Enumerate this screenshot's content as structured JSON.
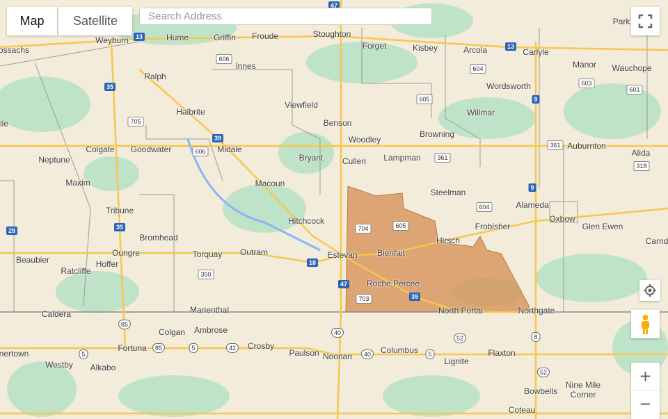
{
  "controls": {
    "map_tab": "Map",
    "satellite_tab": "Satellite",
    "active_tab": "Map",
    "search_placeholder": "Search Address",
    "zoom_in": "+",
    "zoom_out": "−",
    "fullscreen_icon": "fullscreen-icon",
    "locate_icon": "my-location-icon",
    "pegman_icon": "street-view-pegman-icon"
  },
  "colors": {
    "land": "#f4ecda",
    "park": "#bfe3c8",
    "road": "#f7c64a",
    "highlight_region": "#d7925a",
    "border": "#8a8a8a",
    "water": "#8ab4f8"
  },
  "towns": [
    "Hume",
    "Griffin",
    "Froude",
    "Stoughton",
    "Weyburn",
    "Forget",
    "Kisbey",
    "Arcola",
    "Carlyle",
    "Park",
    "ossachs",
    "Innes",
    "Manor",
    "Wauchope",
    "Ralph",
    "Wordsworth",
    "Viewfield",
    "Willmar",
    "Halbrite",
    "Benson",
    "lle",
    "Browning",
    "Woodley",
    "Auburnton",
    "Colgate",
    "Goodwater",
    "Midale",
    "Alida",
    "Neptune",
    "Bryant",
    "Cullen",
    "Lampman",
    "Maxim",
    "Macoun",
    "Steelman",
    "Alameda",
    "Tribune",
    "Oxbow",
    "Hitchcock",
    "Frobisher",
    "Glen Ewen",
    "Bromhead",
    "Hirsch",
    "Carnd",
    "Oungre",
    "Torquay",
    "Outram",
    "Estevan",
    "Bienfait",
    "Beaubier",
    "Hoffer",
    "Ratcliffe",
    "Roche Percee",
    "Marienthal",
    "North Portal",
    "Northgate",
    "Caldera",
    "Colgan",
    "Ambrose",
    "Fortuna",
    "Crosby",
    "Paulson",
    "Noonan",
    "Columbus",
    "Flaxton",
    "Lignite",
    "nertown",
    "Westby",
    "Alkabo",
    "Nine Mile",
    "Corner",
    "Bowbells",
    "Coteau"
  ],
  "routes": [
    "13",
    "13",
    "47",
    "47",
    "606",
    "606",
    "35",
    "35",
    "705",
    "39",
    "39",
    "605",
    "605",
    "604",
    "604",
    "603",
    "601",
    "9",
    "9",
    "361",
    "361",
    "318",
    "28",
    "704",
    "18",
    "350",
    "703",
    "85",
    "85",
    "5",
    "5",
    "5",
    "42",
    "40",
    "40",
    "52",
    "52",
    "8"
  ]
}
